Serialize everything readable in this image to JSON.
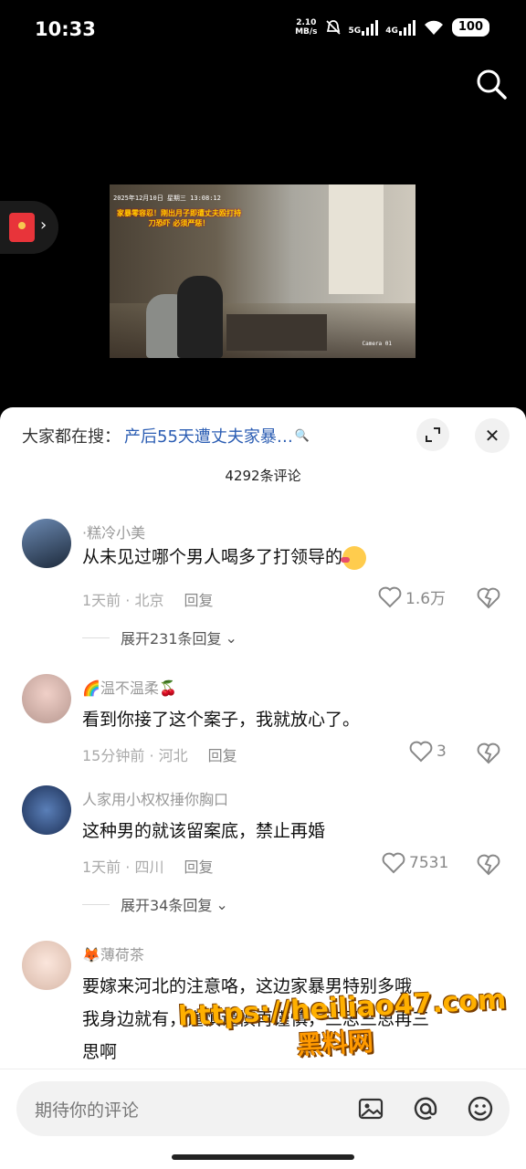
{
  "status_bar": {
    "time": "10:33",
    "net_speed_value": "2.10",
    "net_speed_unit": "MB/s",
    "sig1_label": "5G",
    "sig2_label": "4G",
    "battery": "100"
  },
  "video": {
    "timestamp": "2025年12月10日 星期三 13:08:12",
    "camera": "Camera 01",
    "caption": "家暴零容忍！刚出月子即遭丈夫殴打持刀恐吓 必须严惩！"
  },
  "sheet": {
    "hot_search_label": "大家都在搜：",
    "hot_search_query": "产后55天遭丈夫家暴…",
    "comment_count": "4292条评论"
  },
  "comments": [
    {
      "username": "·糕冷小美",
      "text": "从未见过哪个男人喝多了打领导的",
      "time": "1天前",
      "location": "北京",
      "reply": "回复",
      "likes": "1.6万",
      "expand": "展开231条回复"
    },
    {
      "username": "温不温柔",
      "text": "看到你接了这个案子，我就放心了。",
      "time": "15分钟前",
      "location": "河北",
      "reply": "回复",
      "likes": "3"
    },
    {
      "username": "人家用小权权捶你胸口",
      "text": "这种男的就该留案底，禁止再婚",
      "time": "1天前",
      "location": "四川",
      "reply": "回复",
      "likes": "7531",
      "expand": "展开34条回复"
    },
    {
      "username": "薄荷茶",
      "text_line1": "要嫁来河北的注意咯，这边家暴男特别多哦",
      "text_line2": "我身边就有，谨慎谨慎再谨慎，三思三思再三",
      "text_line3": "思啊"
    }
  ],
  "watermark": {
    "line1": "https://heiliao47.com",
    "line2": "黑料网"
  },
  "input": {
    "placeholder": "期待你的评论"
  },
  "colors": {
    "link_blue": "#2b5db3",
    "sheet_bg": "#ffffff",
    "watermark": "#ffb000"
  }
}
